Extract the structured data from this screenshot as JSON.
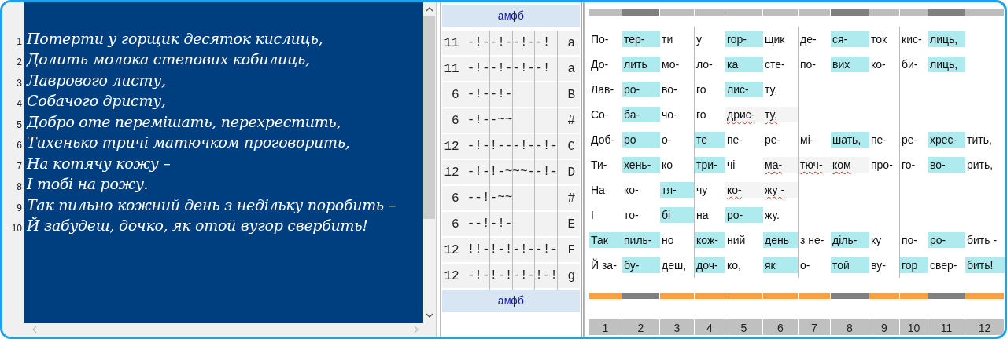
{
  "editor": {
    "lines": [
      {
        "number": "1",
        "text": "Потерти у горщик десяток кислиць,"
      },
      {
        "number": "2",
        "text": "Долить молока степових кобилиць,"
      },
      {
        "number": "3",
        "text": "Лаврового листу,"
      },
      {
        "number": "4",
        "text": "Собачого дристу,"
      },
      {
        "number": "5",
        "text": "Добро оте перемішать, перехрестить,"
      },
      {
        "number": "6",
        "text": "Тихенько тричі матючком проговорить,"
      },
      {
        "number": "7",
        "text": "На котячу кожу –"
      },
      {
        "number": "8",
        "text": "І тобі на рожу."
      },
      {
        "number": "9",
        "text": "Так пильно кожний день з недільку поробить –"
      },
      {
        "number": "10",
        "text": "Й забудеш, дочко, як отой вугор свербить!"
      }
    ]
  },
  "meter": {
    "header": "амфб",
    "rows": [
      {
        "count": "11",
        "pattern": "-!--!--!--!",
        "rhyme": "a"
      },
      {
        "count": "11",
        "pattern": "-!--!--!--!",
        "rhyme": "a"
      },
      {
        "count": "6",
        "pattern": "-!--!-",
        "rhyme": "B"
      },
      {
        "count": "6",
        "pattern": "-!--~~",
        "rhyme": "#"
      },
      {
        "count": "12",
        "pattern": "-!-!---!--!-",
        "rhyme": "C"
      },
      {
        "count": "12",
        "pattern": "-!-!-~~~--!-",
        "rhyme": "D"
      },
      {
        "count": "6",
        "pattern": "--!-~~",
        "rhyme": "#"
      },
      {
        "count": "6",
        "pattern": "--!-!-",
        "rhyme": "E"
      },
      {
        "count": "12",
        "pattern": "!!-!-!-!--!-",
        "rhyme": "F"
      },
      {
        "count": "12",
        "pattern": "-!-!-!-!-!-!",
        "rhyme": "g"
      }
    ],
    "footer": "амфб"
  },
  "syllables": {
    "feet": [
      {
        "accent": false
      },
      {
        "accent": true
      },
      {
        "accent": false
      },
      {
        "accent": false
      },
      {
        "accent": false
      },
      {
        "accent": false
      },
      {
        "accent": false
      },
      {
        "accent": true
      },
      {
        "accent": false
      },
      {
        "accent": false
      },
      {
        "accent": true
      },
      {
        "accent": false
      }
    ],
    "rows": [
      {
        "cells": [
          {
            "text": "По-",
            "kind": "plain"
          },
          {
            "text": "тер-",
            "kind": "stress"
          },
          {
            "text": "ти",
            "kind": "plain"
          },
          {
            "text": "у",
            "kind": "plain"
          },
          {
            "text": "гор-",
            "kind": "stress"
          },
          {
            "text": "щик",
            "kind": "plain"
          },
          {
            "text": "де-",
            "kind": "plain"
          },
          {
            "text": "ся-",
            "kind": "stress"
          },
          {
            "text": "ток",
            "kind": "plain"
          },
          {
            "text": "кис-",
            "kind": "plain"
          },
          {
            "text": "лиць,",
            "kind": "stress"
          }
        ]
      },
      {
        "cells": [
          {
            "text": "До-",
            "kind": "plain"
          },
          {
            "text": "лить",
            "kind": "stress"
          },
          {
            "text": "мо-",
            "kind": "plain"
          },
          {
            "text": "ло-",
            "kind": "plain"
          },
          {
            "text": "ка",
            "kind": "stress"
          },
          {
            "text": "сте-",
            "kind": "plain"
          },
          {
            "text": "по-",
            "kind": "plain"
          },
          {
            "text": "вих",
            "kind": "stress"
          },
          {
            "text": "ко-",
            "kind": "plain"
          },
          {
            "text": "би-",
            "kind": "plain"
          },
          {
            "text": "лиць,",
            "kind": "stress"
          }
        ]
      },
      {
        "cells": [
          {
            "text": "Лав-",
            "kind": "plain"
          },
          {
            "text": "ро-",
            "kind": "stress"
          },
          {
            "text": "во-",
            "kind": "plain"
          },
          {
            "text": "го",
            "kind": "plain"
          },
          {
            "text": "лис-",
            "kind": "stress"
          },
          {
            "text": "ту,",
            "kind": "plain"
          }
        ]
      },
      {
        "cells": [
          {
            "text": "Со-",
            "kind": "plain"
          },
          {
            "text": "ба-",
            "kind": "stress"
          },
          {
            "text": "чо-",
            "kind": "plain"
          },
          {
            "text": "го",
            "kind": "plain"
          },
          {
            "text": "дрис-",
            "kind": "faint"
          },
          {
            "text": "ту,",
            "kind": "faint"
          }
        ]
      },
      {
        "cells": [
          {
            "text": "Доб-",
            "kind": "plain"
          },
          {
            "text": "ро",
            "kind": "stress"
          },
          {
            "text": "о-",
            "kind": "plain"
          },
          {
            "text": "те",
            "kind": "stress"
          },
          {
            "text": "пе-",
            "kind": "plain"
          },
          {
            "text": "ре-",
            "kind": "plain"
          },
          {
            "text": "мі-",
            "kind": "plain"
          },
          {
            "text": "шать,",
            "kind": "stress"
          },
          {
            "text": "пе-",
            "kind": "plain"
          },
          {
            "text": "ре-",
            "kind": "plain"
          },
          {
            "text": "хрес-",
            "kind": "stress"
          },
          {
            "text": "тить,",
            "kind": "plain"
          }
        ]
      },
      {
        "cells": [
          {
            "text": "Ти-",
            "kind": "plain"
          },
          {
            "text": "хень-",
            "kind": "stress"
          },
          {
            "text": "ко",
            "kind": "plain"
          },
          {
            "text": "три-",
            "kind": "stress"
          },
          {
            "text": "чі",
            "kind": "plain"
          },
          {
            "text": "ма-",
            "kind": "faint"
          },
          {
            "text": "тюч-",
            "kind": "faint"
          },
          {
            "text": "ком",
            "kind": "faint"
          },
          {
            "text": "про-",
            "kind": "plain"
          },
          {
            "text": "го-",
            "kind": "plain"
          },
          {
            "text": "во-",
            "kind": "stress"
          },
          {
            "text": "рить,",
            "kind": "plain"
          }
        ]
      },
      {
        "cells": [
          {
            "text": "На",
            "kind": "plain"
          },
          {
            "text": "ко-",
            "kind": "plain"
          },
          {
            "text": "тя-",
            "kind": "stress"
          },
          {
            "text": "чу",
            "kind": "plain"
          },
          {
            "text": "ко-",
            "kind": "faint"
          },
          {
            "text": "жу -",
            "kind": "faint"
          }
        ]
      },
      {
        "cells": [
          {
            "text": "І",
            "kind": "plain"
          },
          {
            "text": "то-",
            "kind": "plain"
          },
          {
            "text": "бі",
            "kind": "stress"
          },
          {
            "text": "на",
            "kind": "plain"
          },
          {
            "text": "ро-",
            "kind": "stress"
          },
          {
            "text": "жу.",
            "kind": "plain"
          }
        ]
      },
      {
        "cells": [
          {
            "text": "Так",
            "kind": "stress"
          },
          {
            "text": "пиль-",
            "kind": "stress"
          },
          {
            "text": "но",
            "kind": "plain"
          },
          {
            "text": "кож-",
            "kind": "stress"
          },
          {
            "text": "ний",
            "kind": "plain"
          },
          {
            "text": "день",
            "kind": "stress"
          },
          {
            "text": "з не-",
            "kind": "plain"
          },
          {
            "text": "діль-",
            "kind": "stress"
          },
          {
            "text": "ку",
            "kind": "plain"
          },
          {
            "text": "по-",
            "kind": "plain"
          },
          {
            "text": "ро-",
            "kind": "stress"
          },
          {
            "text": "бить -",
            "kind": "plain"
          }
        ]
      },
      {
        "cells": [
          {
            "text": "Й за-",
            "kind": "plain"
          },
          {
            "text": "бу-",
            "kind": "stress"
          },
          {
            "text": "деш,",
            "kind": "plain"
          },
          {
            "text": "доч-",
            "kind": "stress"
          },
          {
            "text": "ко,",
            "kind": "plain"
          },
          {
            "text": "як",
            "kind": "stress"
          },
          {
            "text": "о-",
            "kind": "plain"
          },
          {
            "text": "той",
            "kind": "stress"
          },
          {
            "text": "ву-",
            "kind": "plain"
          },
          {
            "text": "гор",
            "kind": "stress"
          },
          {
            "text": "свер-",
            "kind": "plain"
          },
          {
            "text": "бить!",
            "kind": "stress"
          }
        ]
      }
    ],
    "column_numbers": [
      "1",
      "2",
      "3",
      "4",
      "5",
      "6",
      "7",
      "8",
      "9",
      "10",
      "11",
      "12"
    ]
  }
}
